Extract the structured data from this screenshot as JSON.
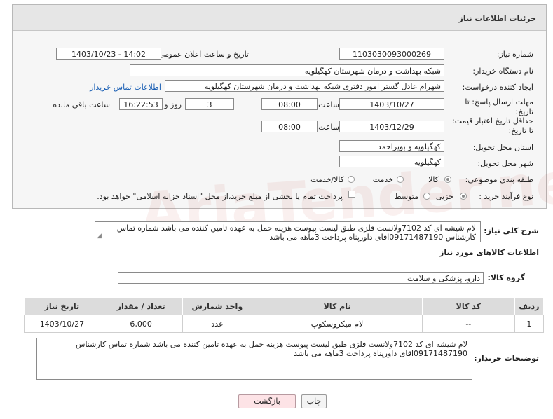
{
  "panel_title": "جزئیات اطلاعات نیاز",
  "fields": {
    "need_number_label": "شماره نیاز:",
    "need_number": "1103030093000269",
    "announce_label": "تاریخ و ساعت اعلان عمومی:",
    "announce_value": "1403/10/23 - 14:02",
    "buyer_org_label": "نام دستگاه خریدار:",
    "buyer_org": "شبکه بهداشت و درمان شهرستان کهگیلویه",
    "creator_label": "ایجاد کننده درخواست:",
    "creator": "شهرام عادل گستر امور دفتری شبکه بهداشت و درمان شهرستان کهگیلویه",
    "contact_link": "اطلاعات تماس خریدار",
    "deadline_label": "مهلت ارسال پاسخ: تا تاریخ:",
    "deadline_date": "1403/10/27",
    "time_label": "ساعت",
    "deadline_time": "08:00",
    "days_value": "3",
    "days_label": "روز و",
    "remaining_time": "16:22:53",
    "remaining_label": "ساعت باقی مانده",
    "price_validity_label": "حداقل تاریخ اعتبار قیمت: تا تاریخ:",
    "price_validity_date": "1403/12/29",
    "price_validity_time": "08:00",
    "province_label": "استان محل تحویل:",
    "province": "کهگیلویه و بویراحمد",
    "city_label": "شهر محل تحویل:",
    "city": "کهگیلویه",
    "category_label": "طبقه بندی موضوعی:",
    "category_options": [
      "کالا",
      "خدمت",
      "کالا/خدمت"
    ],
    "category_selected": "کالا",
    "process_label": "نوع فرآیند خرید :",
    "process_options": [
      "جزیی",
      "متوسط"
    ],
    "process_selected": "جزیی",
    "payment_note": "پرداخت تمام یا بخشی از مبلغ خرید،از محل \"اسناد خزانه اسلامی\" خواهد بود."
  },
  "description_label": "شرح کلی نیاز:",
  "description": "لام شیشه ای کد 7102ولانست فلزی طبق لیست پیوست هزینه حمل به عهده تامین کننده می باشد شماره تماس کارشناس 09171487190اقای داورپناه پرداخت 3ماهه می باشد",
  "goods_section_title": "اطلاعات کالاهای مورد نیاز",
  "goods_group_label": "گروه کالا:",
  "goods_group": "دارو، پزشکی و سلامت",
  "table": {
    "headers": [
      "ردیف",
      "کد کالا",
      "نام کالا",
      "واحد شمارش",
      "تعداد / مقدار",
      "تاریخ نیاز"
    ],
    "rows": [
      [
        "1",
        "--",
        "لام میکروسکوپ",
        "عدد",
        "6,000",
        "1403/10/27"
      ]
    ]
  },
  "buyer_notes_label": "توضیحات خریدار:",
  "buyer_notes": "لام شیشه ای کد 7102ولانست فلزی طبق لیست پیوست هزینه حمل به عهده تامین کننده می باشد شماره تماس کارشناس 09171487190اقای داورپناه پرداخت 3ماهه می باشد",
  "buttons": {
    "print": "چاپ",
    "back": "بازگشت"
  },
  "watermark": "AriaTender.net"
}
